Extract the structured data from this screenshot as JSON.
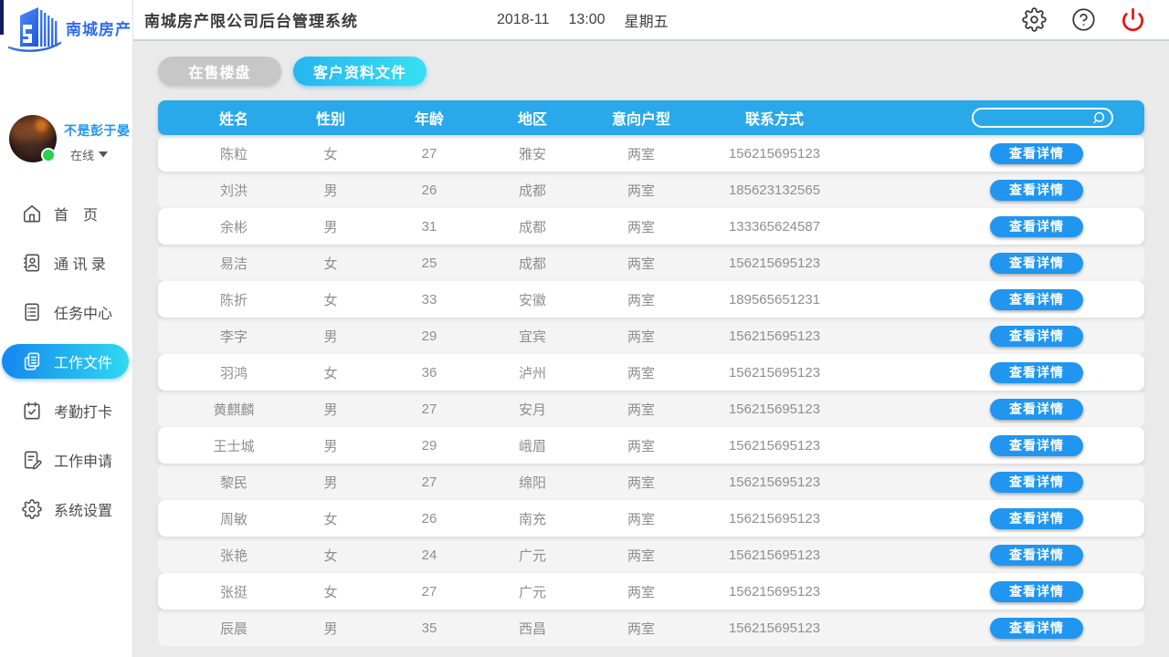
{
  "header": {
    "title": "南城房产限公司后台管理系统",
    "date": "2018-11",
    "time": "13:00",
    "weekday": "星期五",
    "icons": [
      "gear-icon",
      "help-icon",
      "power-icon"
    ]
  },
  "sidebar": {
    "brand": "南城房产",
    "user": {
      "name": "不是彭于晏",
      "status": "在线"
    },
    "menu": [
      {
        "label": "首　页",
        "icon": "home-icon",
        "active": false
      },
      {
        "label": "通 讯 录",
        "icon": "contacts-icon",
        "active": false
      },
      {
        "label": "任务中心",
        "icon": "task-list-icon",
        "active": false
      },
      {
        "label": "工作文件",
        "icon": "documents-icon",
        "active": true
      },
      {
        "label": "考勤打卡",
        "icon": "calendar-check-icon",
        "active": false
      },
      {
        "label": "工作申请",
        "icon": "edit-doc-icon",
        "active": false
      },
      {
        "label": "系统设置",
        "icon": "gear-icon",
        "active": false
      }
    ]
  },
  "tabs": [
    {
      "label": "在售楼盘",
      "active": false
    },
    {
      "label": "客户资料文件",
      "active": true
    }
  ],
  "table": {
    "columns": [
      "姓名",
      "性别",
      "年龄",
      "地区",
      "意向户型",
      "联系方式"
    ],
    "search": {
      "value": "",
      "placeholder": ""
    },
    "action_label": "查看详情",
    "rows": [
      {
        "name": "陈粒",
        "gender": "女",
        "age": "27",
        "region": "雅安",
        "type": "两室",
        "phone": "156215695123"
      },
      {
        "name": "刘洪",
        "gender": "男",
        "age": "26",
        "region": "成都",
        "type": "两室",
        "phone": "185623132565"
      },
      {
        "name": "余彬",
        "gender": "男",
        "age": "31",
        "region": "成都",
        "type": "两室",
        "phone": "133365624587"
      },
      {
        "name": "易洁",
        "gender": "女",
        "age": "25",
        "region": "成都",
        "type": "两室",
        "phone": "156215695123"
      },
      {
        "name": "陈折",
        "gender": "女",
        "age": "33",
        "region": "安徽",
        "type": "两室",
        "phone": "189565651231"
      },
      {
        "name": "李字",
        "gender": "男",
        "age": "29",
        "region": "宜宾",
        "type": "两室",
        "phone": "156215695123"
      },
      {
        "name": "羽鸿",
        "gender": "女",
        "age": "36",
        "region": "泸州",
        "type": "两室",
        "phone": "156215695123"
      },
      {
        "name": "黄麒麟",
        "gender": "男",
        "age": "27",
        "region": "安月",
        "type": "两室",
        "phone": "156215695123"
      },
      {
        "name": "王士城",
        "gender": "男",
        "age": "29",
        "region": "峨眉",
        "type": "两室",
        "phone": "156215695123"
      },
      {
        "name": "黎民",
        "gender": "男",
        "age": "27",
        "region": "绵阳",
        "type": "两室",
        "phone": "156215695123"
      },
      {
        "name": "周敏",
        "gender": "女",
        "age": "26",
        "region": "南充",
        "type": "两室",
        "phone": "156215695123"
      },
      {
        "name": "张艳",
        "gender": "女",
        "age": "24",
        "region": "广元",
        "type": "两室",
        "phone": "156215695123"
      },
      {
        "name": "张挺",
        "gender": "女",
        "age": "27",
        "region": "广元",
        "type": "两室",
        "phone": "156215695123"
      },
      {
        "name": "辰晨",
        "gender": "男",
        "age": "35",
        "region": "西昌",
        "type": "两室",
        "phone": "156215695123"
      }
    ]
  },
  "colors": {
    "header_blue": "#29a9ea",
    "button_blue": "#2096f0",
    "tab_grad_start": "#27b5f0",
    "tab_grad_end": "#36e0f2",
    "active_grad_start": "#1487f0",
    "active_grad_end": "#30d9f0",
    "tab_gray": "#c7c7c7",
    "power_red": "#e8130c",
    "brand_blue": "#2e6bf0",
    "name_blue": "#2196f3",
    "online_green": "#25d04a"
  }
}
